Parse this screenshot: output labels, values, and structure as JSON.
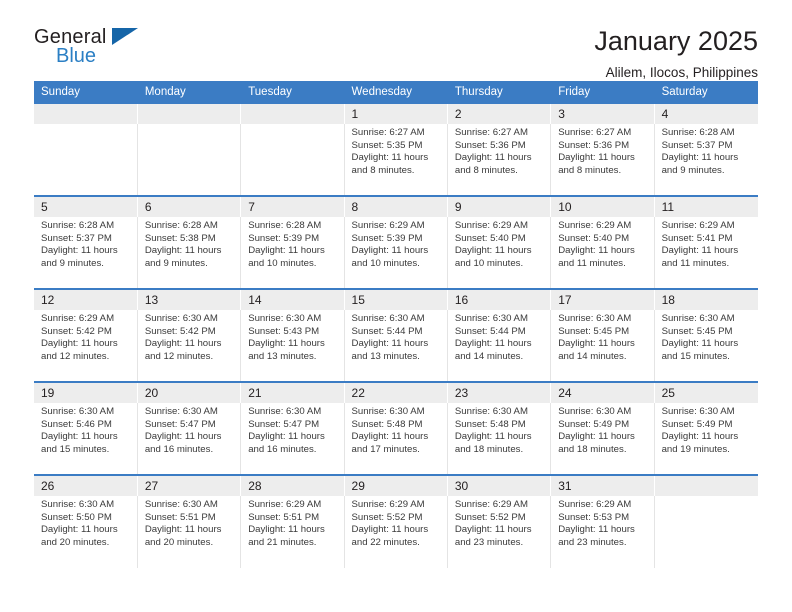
{
  "logo": {
    "name_part1": "General",
    "name_part2": "Blue",
    "triangle_color": "#1565a8",
    "blue_color": "#2b7fc4"
  },
  "header": {
    "title": "January 2025",
    "subtitle": "Alilem, Ilocos, Philippines"
  },
  "theme": {
    "header_bg": "#3b7cc4",
    "daynum_bg": "#ededed",
    "text": "#231f20"
  },
  "calendar": {
    "weekday_headers": [
      "Sunday",
      "Monday",
      "Tuesday",
      "Wednesday",
      "Thursday",
      "Friday",
      "Saturday"
    ],
    "weeks": [
      [
        {
          "day": "",
          "lines": []
        },
        {
          "day": "",
          "lines": []
        },
        {
          "day": "",
          "lines": []
        },
        {
          "day": "1",
          "lines": [
            "Sunrise: 6:27 AM",
            "Sunset: 5:35 PM",
            "Daylight: 11 hours",
            "and 8 minutes."
          ]
        },
        {
          "day": "2",
          "lines": [
            "Sunrise: 6:27 AM",
            "Sunset: 5:36 PM",
            "Daylight: 11 hours",
            "and 8 minutes."
          ]
        },
        {
          "day": "3",
          "lines": [
            "Sunrise: 6:27 AM",
            "Sunset: 5:36 PM",
            "Daylight: 11 hours",
            "and 8 minutes."
          ]
        },
        {
          "day": "4",
          "lines": [
            "Sunrise: 6:28 AM",
            "Sunset: 5:37 PM",
            "Daylight: 11 hours",
            "and 9 minutes."
          ]
        }
      ],
      [
        {
          "day": "5",
          "lines": [
            "Sunrise: 6:28 AM",
            "Sunset: 5:37 PM",
            "Daylight: 11 hours",
            "and 9 minutes."
          ]
        },
        {
          "day": "6",
          "lines": [
            "Sunrise: 6:28 AM",
            "Sunset: 5:38 PM",
            "Daylight: 11 hours",
            "and 9 minutes."
          ]
        },
        {
          "day": "7",
          "lines": [
            "Sunrise: 6:28 AM",
            "Sunset: 5:39 PM",
            "Daylight: 11 hours",
            "and 10 minutes."
          ]
        },
        {
          "day": "8",
          "lines": [
            "Sunrise: 6:29 AM",
            "Sunset: 5:39 PM",
            "Daylight: 11 hours",
            "and 10 minutes."
          ]
        },
        {
          "day": "9",
          "lines": [
            "Sunrise: 6:29 AM",
            "Sunset: 5:40 PM",
            "Daylight: 11 hours",
            "and 10 minutes."
          ]
        },
        {
          "day": "10",
          "lines": [
            "Sunrise: 6:29 AM",
            "Sunset: 5:40 PM",
            "Daylight: 11 hours",
            "and 11 minutes."
          ]
        },
        {
          "day": "11",
          "lines": [
            "Sunrise: 6:29 AM",
            "Sunset: 5:41 PM",
            "Daylight: 11 hours",
            "and 11 minutes."
          ]
        }
      ],
      [
        {
          "day": "12",
          "lines": [
            "Sunrise: 6:29 AM",
            "Sunset: 5:42 PM",
            "Daylight: 11 hours",
            "and 12 minutes."
          ]
        },
        {
          "day": "13",
          "lines": [
            "Sunrise: 6:30 AM",
            "Sunset: 5:42 PM",
            "Daylight: 11 hours",
            "and 12 minutes."
          ]
        },
        {
          "day": "14",
          "lines": [
            "Sunrise: 6:30 AM",
            "Sunset: 5:43 PM",
            "Daylight: 11 hours",
            "and 13 minutes."
          ]
        },
        {
          "day": "15",
          "lines": [
            "Sunrise: 6:30 AM",
            "Sunset: 5:44 PM",
            "Daylight: 11 hours",
            "and 13 minutes."
          ]
        },
        {
          "day": "16",
          "lines": [
            "Sunrise: 6:30 AM",
            "Sunset: 5:44 PM",
            "Daylight: 11 hours",
            "and 14 minutes."
          ]
        },
        {
          "day": "17",
          "lines": [
            "Sunrise: 6:30 AM",
            "Sunset: 5:45 PM",
            "Daylight: 11 hours",
            "and 14 minutes."
          ]
        },
        {
          "day": "18",
          "lines": [
            "Sunrise: 6:30 AM",
            "Sunset: 5:45 PM",
            "Daylight: 11 hours",
            "and 15 minutes."
          ]
        }
      ],
      [
        {
          "day": "19",
          "lines": [
            "Sunrise: 6:30 AM",
            "Sunset: 5:46 PM",
            "Daylight: 11 hours",
            "and 15 minutes."
          ]
        },
        {
          "day": "20",
          "lines": [
            "Sunrise: 6:30 AM",
            "Sunset: 5:47 PM",
            "Daylight: 11 hours",
            "and 16 minutes."
          ]
        },
        {
          "day": "21",
          "lines": [
            "Sunrise: 6:30 AM",
            "Sunset: 5:47 PM",
            "Daylight: 11 hours",
            "and 16 minutes."
          ]
        },
        {
          "day": "22",
          "lines": [
            "Sunrise: 6:30 AM",
            "Sunset: 5:48 PM",
            "Daylight: 11 hours",
            "and 17 minutes."
          ]
        },
        {
          "day": "23",
          "lines": [
            "Sunrise: 6:30 AM",
            "Sunset: 5:48 PM",
            "Daylight: 11 hours",
            "and 18 minutes."
          ]
        },
        {
          "day": "24",
          "lines": [
            "Sunrise: 6:30 AM",
            "Sunset: 5:49 PM",
            "Daylight: 11 hours",
            "and 18 minutes."
          ]
        },
        {
          "day": "25",
          "lines": [
            "Sunrise: 6:30 AM",
            "Sunset: 5:49 PM",
            "Daylight: 11 hours",
            "and 19 minutes."
          ]
        }
      ],
      [
        {
          "day": "26",
          "lines": [
            "Sunrise: 6:30 AM",
            "Sunset: 5:50 PM",
            "Daylight: 11 hours",
            "and 20 minutes."
          ]
        },
        {
          "day": "27",
          "lines": [
            "Sunrise: 6:30 AM",
            "Sunset: 5:51 PM",
            "Daylight: 11 hours",
            "and 20 minutes."
          ]
        },
        {
          "day": "28",
          "lines": [
            "Sunrise: 6:29 AM",
            "Sunset: 5:51 PM",
            "Daylight: 11 hours",
            "and 21 minutes."
          ]
        },
        {
          "day": "29",
          "lines": [
            "Sunrise: 6:29 AM",
            "Sunset: 5:52 PM",
            "Daylight: 11 hours",
            "and 22 minutes."
          ]
        },
        {
          "day": "30",
          "lines": [
            "Sunrise: 6:29 AM",
            "Sunset: 5:52 PM",
            "Daylight: 11 hours",
            "and 23 minutes."
          ]
        },
        {
          "day": "31",
          "lines": [
            "Sunrise: 6:29 AM",
            "Sunset: 5:53 PM",
            "Daylight: 11 hours",
            "and 23 minutes."
          ]
        },
        {
          "day": "",
          "lines": []
        }
      ]
    ]
  }
}
